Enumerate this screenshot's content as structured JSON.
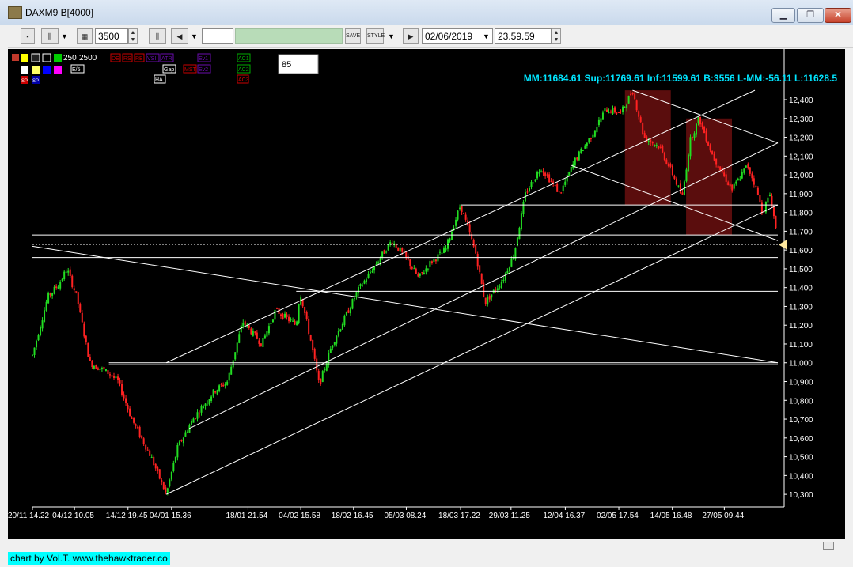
{
  "window": {
    "title": "DAXM9 B[4000]",
    "buttons": {
      "minimize": "▁",
      "restore": "❐",
      "close": "✕"
    }
  },
  "toolbar": {
    "bars_value": "3500",
    "save_label": "SAVE",
    "style_label": "STYLE",
    "date_value": "02/06/2019",
    "time_value": "23.59.59"
  },
  "indicator_panel": {
    "row1_labels": [
      "250",
      "2500"
    ],
    "boxes1": [
      "DE",
      "RS",
      "RB",
      "VSI",
      "ATR",
      "Ev1",
      "AC1"
    ],
    "boxes2": [
      "E/5",
      "Gap",
      "MST",
      "Ev2",
      "AC2"
    ],
    "boxes3": [
      "HA",
      "AC3"
    ],
    "boxes_left": [
      "SP",
      "SP"
    ],
    "period_value": "85"
  },
  "info_line": "MM:11684.61 Sup:11769.61 Inf:11599.61 B:3556 L-MM:-56.11 L:11628.5",
  "footer": "chart by Vol.T. www.thehawktrader.co",
  "colors": {
    "up": "#22dd22",
    "down": "#ff2222",
    "lines": "#ffffff",
    "info": "#00e5ff",
    "zone": "#5a0d0d"
  },
  "chart_data": {
    "type": "candlestick",
    "ylim": [
      10250,
      12480
    ],
    "y_ticks": [
      10300,
      10400,
      10500,
      10600,
      10700,
      10800,
      10900,
      11000,
      11100,
      11200,
      11300,
      11400,
      11500,
      11600,
      11700,
      11800,
      11900,
      12000,
      12100,
      12200,
      12300,
      12400
    ],
    "x_tick_labels": [
      "20/11 14.22",
      "04/12 10.05",
      "14/12 19.45",
      "04/01 15.36",
      "18/01 21.54",
      "04/02 15.58",
      "18/02 16.45",
      "05/03 08.24",
      "18/03 17.22",
      "29/03 11.25",
      "12/04 16.37",
      "02/05 17.54",
      "14/05 16.48",
      "27/05 09.44"
    ],
    "path_keypoints": [
      [
        0,
        11040
      ],
      [
        20,
        11350
      ],
      [
        35,
        11420
      ],
      [
        45,
        11500
      ],
      [
        58,
        11350
      ],
      [
        75,
        11000
      ],
      [
        98,
        10950
      ],
      [
        112,
        10900
      ],
      [
        130,
        10700
      ],
      [
        155,
        10500
      ],
      [
        175,
        10300
      ],
      [
        190,
        10550
      ],
      [
        210,
        10700
      ],
      [
        238,
        10850
      ],
      [
        255,
        10900
      ],
      [
        275,
        11220
      ],
      [
        300,
        11100
      ],
      [
        318,
        11280
      ],
      [
        345,
        11200
      ],
      [
        350,
        11380
      ],
      [
        365,
        11100
      ],
      [
        375,
        10880
      ],
      [
        392,
        11100
      ],
      [
        410,
        11250
      ],
      [
        425,
        11380
      ],
      [
        445,
        11500
      ],
      [
        470,
        11650
      ],
      [
        490,
        11550
      ],
      [
        505,
        11450
      ],
      [
        520,
        11530
      ],
      [
        540,
        11600
      ],
      [
        560,
        11840
      ],
      [
        580,
        11580
      ],
      [
        592,
        11320
      ],
      [
        615,
        11440
      ],
      [
        630,
        11580
      ],
      [
        645,
        11900
      ],
      [
        665,
        12040
      ],
      [
        690,
        11900
      ],
      [
        710,
        12080
      ],
      [
        730,
        12200
      ],
      [
        750,
        12350
      ],
      [
        770,
        12330
      ],
      [
        785,
        12450
      ],
      [
        800,
        12200
      ],
      [
        820,
        12150
      ],
      [
        838,
        12000
      ],
      [
        850,
        11880
      ],
      [
        860,
        12180
      ],
      [
        872,
        12300
      ],
      [
        890,
        12100
      ],
      [
        915,
        11920
      ],
      [
        935,
        12050
      ],
      [
        945,
        11950
      ],
      [
        955,
        11800
      ],
      [
        965,
        11900
      ],
      [
        975,
        11650
      ]
    ],
    "horizontal_lines": [
      11680,
      11630,
      11560,
      11380,
      11000,
      10990,
      11840
    ],
    "level_lines": [
      {
        "from_x": 0,
        "to_x": 975,
        "y": 11680
      },
      {
        "from_x": 0,
        "to_x": 975,
        "y": 11630
      },
      {
        "from_x": 0,
        "to_x": 975,
        "y": 11560
      },
      {
        "from_x": 345,
        "to_x": 975,
        "y": 11380
      },
      {
        "from_x": 100,
        "to_x": 975,
        "y": 11000
      },
      {
        "from_x": 100,
        "to_x": 975,
        "y": 10990
      },
      {
        "from_x": 560,
        "to_x": 975,
        "y": 11840
      }
    ],
    "trend_lines": [
      {
        "x1": 0,
        "y1": 11620,
        "x2": 975,
        "y2": 11000
      },
      {
        "x1": 175,
        "y1": 11000,
        "x2": 945,
        "y2": 12450
      },
      {
        "x1": 175,
        "y1": 10300,
        "x2": 975,
        "y2": 11840
      },
      {
        "x1": 205,
        "y1": 10650,
        "x2": 975,
        "y2": 12170
      },
      {
        "x1": 705,
        "y1": 12050,
        "x2": 975,
        "y2": 11650
      },
      {
        "x1": 785,
        "y1": 12450,
        "x2": 975,
        "y2": 12170
      }
    ],
    "zones": [
      {
        "x1": 775,
        "x2": 835,
        "y1": 11840,
        "y2": 12450
      },
      {
        "x1": 855,
        "x2": 915,
        "y1": 11680,
        "y2": 12300
      }
    ],
    "last_price": 11628.5
  }
}
